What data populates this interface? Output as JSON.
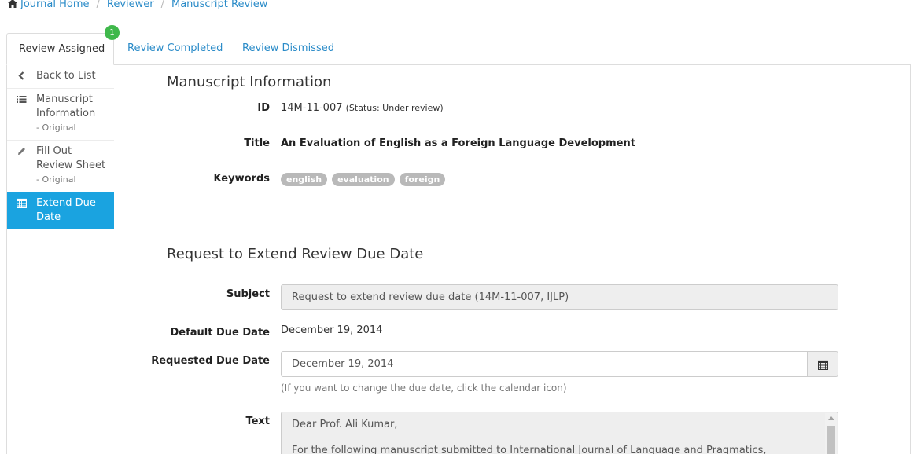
{
  "breadcrumb": {
    "home": "Journal Home",
    "reviewer": "Reviewer",
    "current": "Manuscript Review"
  },
  "tabs": [
    {
      "label": "Review Assigned",
      "badge": "1"
    },
    {
      "label": "Review Completed"
    },
    {
      "label": "Review Dismissed"
    }
  ],
  "sidebar": {
    "items": [
      {
        "label": "Back to List",
        "icon": "chevron-left-icon"
      },
      {
        "label": "Manuscript Information",
        "sub": "- Original",
        "icon": "list-icon"
      },
      {
        "label": "Fill Out Review Sheet",
        "sub": "- Original",
        "icon": "pencil-icon"
      },
      {
        "label": "Extend Due Date",
        "icon": "calendar-icon"
      }
    ]
  },
  "manuscript": {
    "heading": "Manuscript Information",
    "id_label": "ID",
    "id_value": "14M-11-007",
    "status": "(Status: Under review)",
    "title_label": "Title",
    "title_value": "An Evaluation of English as a Foreign Language Development",
    "keywords_label": "Keywords",
    "keywords": [
      "english",
      "evaluation",
      "foreign"
    ]
  },
  "extend": {
    "heading": "Request to Extend Review Due Date",
    "subject_label": "Subject",
    "subject_value": "Request to extend review due date (14M-11-007, IJLP)",
    "default_label": "Default Due Date",
    "default_value": "December 19, 2014",
    "requested_label": "Requested Due Date",
    "requested_value": "December 19, 2014",
    "help": "(If you want to change the due date, click the calendar icon)",
    "text_label": "Text",
    "text_line1": "Dear Prof. Ali Kumar,",
    "text_line2": "For the following manuscript submitted to International Journal of Language and Pragmatics,"
  },
  "colors": {
    "link": "#2a8bc8",
    "active_nav": "#1aa3e0",
    "badge": "#3fb84b",
    "keyword_tag": "#b9b9b9"
  }
}
